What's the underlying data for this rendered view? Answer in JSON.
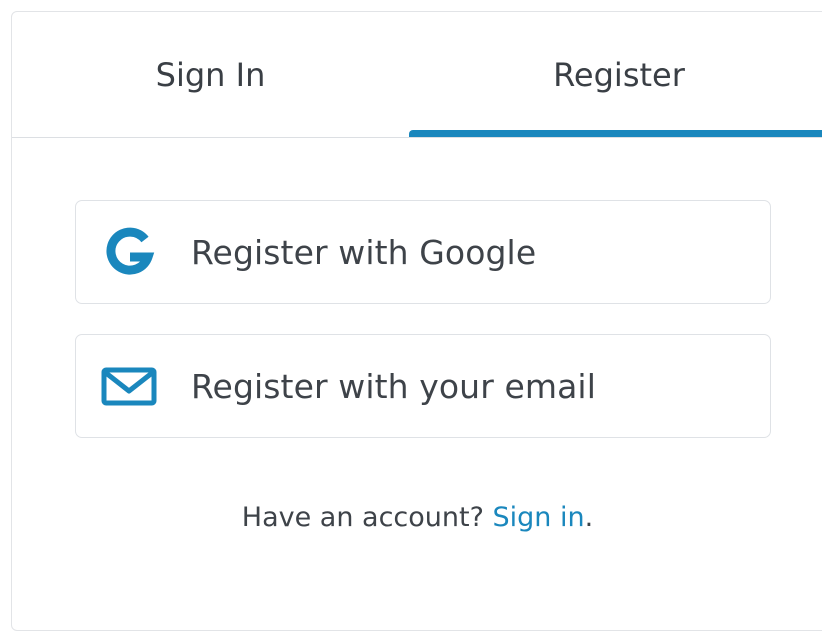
{
  "colors": {
    "accent": "#1a87bd",
    "text": "#3e4349",
    "border": "#dfe2e6"
  },
  "tabs": [
    {
      "label": "Sign In",
      "active": false
    },
    {
      "label": "Register",
      "active": true
    }
  ],
  "buttons": {
    "google": {
      "label": "Register with Google",
      "icon": "google-icon"
    },
    "email": {
      "label": "Register with your email",
      "icon": "mail-icon"
    }
  },
  "footer": {
    "prompt": "Have an account?",
    "link": "Sign in",
    "suffix": "."
  }
}
